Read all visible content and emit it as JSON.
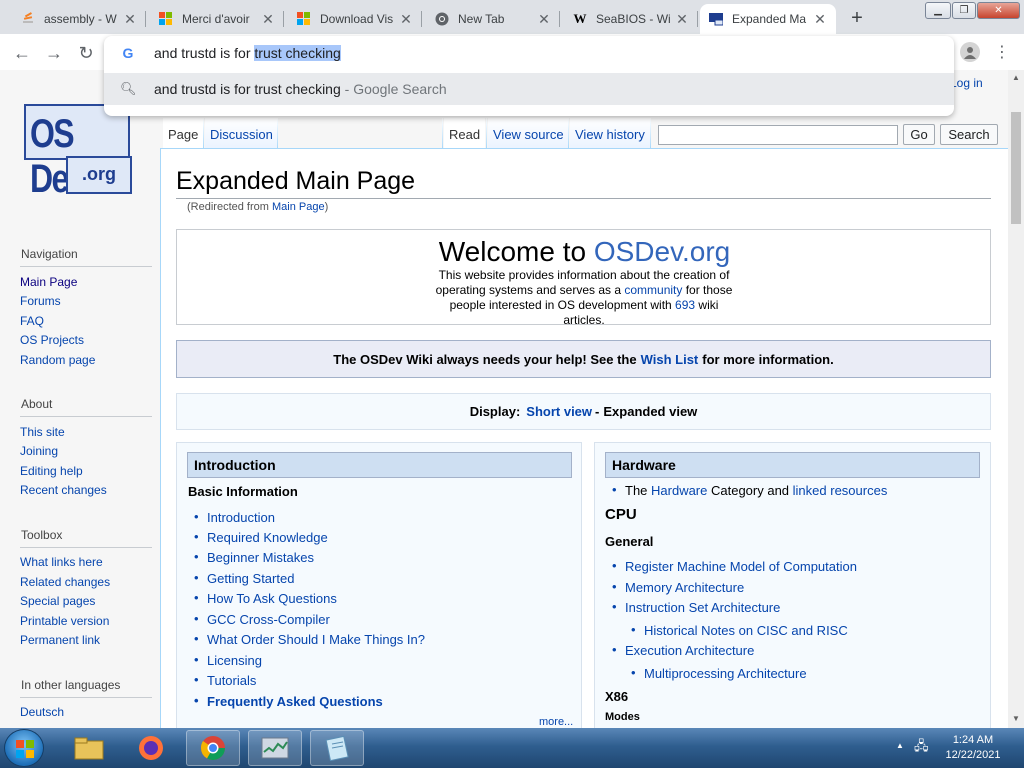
{
  "browser": {
    "tabs": [
      {
        "title": "assembly - W",
        "icon": "stackoverflow-icon"
      },
      {
        "title": "Merci d'avoir",
        "icon": "microsoft-icon"
      },
      {
        "title": "Download Vis",
        "icon": "microsoft-icon"
      },
      {
        "title": "New Tab",
        "icon": "chrome-icon"
      },
      {
        "title": "SeaBIOS - Wi",
        "icon": "wikipedia-icon"
      },
      {
        "title": "Expanded Ma",
        "icon": "osdev-icon"
      }
    ],
    "omnibox": {
      "typed": "and trustd is for ",
      "selected": "trust checking",
      "suggestion": "and trustd is for trust checking",
      "suggestion_suffix": " - Google Search"
    }
  },
  "page": {
    "login": "Log in",
    "logo": {
      "line1": "OS Dev",
      "line2": ".org"
    },
    "tabs": {
      "page": "Page",
      "discussion": "Discussion",
      "read": "Read",
      "view_source": "View source",
      "view_history": "View history"
    },
    "search": {
      "go": "Go",
      "search": "Search"
    },
    "title": "Expanded Main Page",
    "redirect": {
      "prefix": "(Redirected from ",
      "link": "Main Page",
      "suffix": ")"
    },
    "sidebar": {
      "navigation": {
        "heading": "Navigation",
        "items": [
          "Main Page",
          "Forums",
          "FAQ",
          "OS Projects",
          "Random page"
        ]
      },
      "about": {
        "heading": "About",
        "items": [
          "This site",
          "Joining",
          "Editing help",
          "Recent changes"
        ]
      },
      "toolbox": {
        "heading": "Toolbox",
        "items": [
          "What links here",
          "Related changes",
          "Special pages",
          "Printable version",
          "Permanent link"
        ]
      },
      "languages": {
        "heading": "In other languages",
        "items": [
          "Deutsch"
        ]
      }
    },
    "welcome": {
      "title_prefix": "Welcome to ",
      "title_link": "OSDev.org",
      "desc_1": "This website provides information about the creation of operating systems and serves as a ",
      "desc_link": "community",
      "desc_2": " for those people interested in OS development with ",
      "desc_count": "693",
      "desc_3": " wiki articles."
    },
    "wish": {
      "prefix": "The OSDev Wiki always needs your help! See the",
      "link": "Wish List",
      "suffix": "for more information."
    },
    "display": {
      "label": "Display:",
      "short": "Short view",
      "sep": "-",
      "expanded": "Expanded view"
    },
    "intro": {
      "heading": "Introduction",
      "subheading": "Basic Information",
      "items": [
        "Introduction",
        "Required Knowledge",
        "Beginner Mistakes",
        "Getting Started",
        "How To Ask Questions",
        "GCC Cross-Compiler",
        "What Order Should I Make Things In?",
        "Licensing",
        "Tutorials"
      ],
      "faq": "Frequently Asked Questions",
      "more": "more..."
    },
    "hardware": {
      "heading": "Hardware",
      "line_prefix": "The ",
      "line_link1": "Hardware",
      "line_mid": " Category and ",
      "line_link2": "linked resources",
      "cpu": "CPU",
      "general": "General",
      "items": [
        "Register Machine Model of Computation",
        "Memory Architecture",
        "Instruction Set Architecture",
        "Historical Notes on CISC and RISC",
        "Execution Architecture",
        "Multiprocessing Architecture"
      ],
      "x86": "X86",
      "modes": "Modes"
    }
  },
  "taskbar": {
    "time": "1:24 AM",
    "date": "12/22/2021"
  }
}
